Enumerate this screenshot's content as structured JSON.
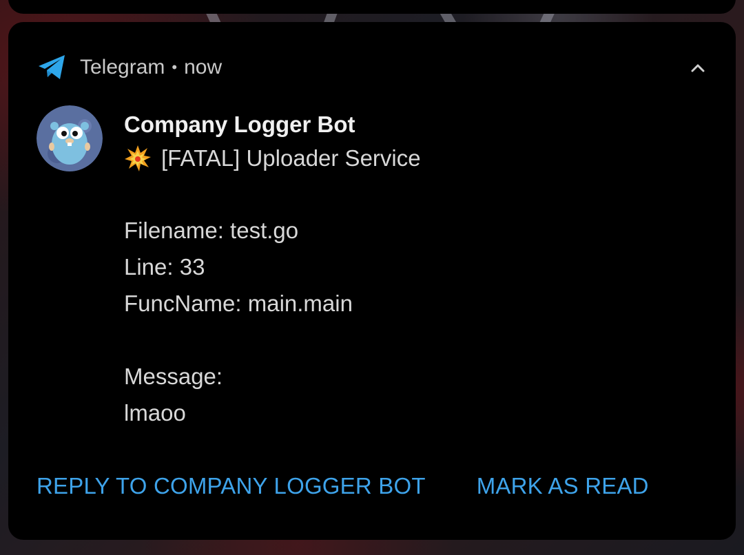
{
  "notification": {
    "app_name": "Telegram",
    "separator": "•",
    "time": "now",
    "title": "Company Logger Bot",
    "subtitle": "[FATAL] Uploader Service",
    "body": {
      "filename": "Filename: test.go",
      "line": "Line: 33",
      "funcname": "FuncName: main.main",
      "message_label": "Message:",
      "message_text": "lmaoo"
    },
    "actions": {
      "reply": "REPLY TO COMPANY LOGGER BOT",
      "mark_read": "MARK AS READ"
    },
    "icons": {
      "app": "telegram-plane-icon",
      "collapse": "chevron-up-icon",
      "avatar": "gopher-avatar",
      "emoji": "collision-emoji-icon"
    },
    "colors": {
      "card_background": "#000000",
      "accent": "#3ea3ea",
      "telegram_blue": "#2ea6ea",
      "primary_text": "#f0f0f0",
      "secondary_text": "#c9c9c9"
    }
  }
}
